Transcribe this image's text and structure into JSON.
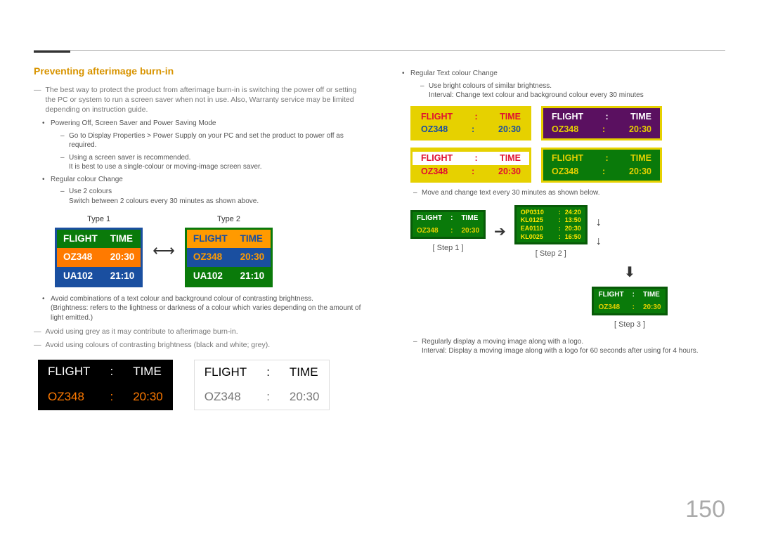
{
  "page_number": "150",
  "section_title": "Preventing afterimage burn-in",
  "intro": "The best way to protect the product from afterimage burn-in is switching the power off or setting the PC or system to run a screen saver when not in use. Also, Warranty service may be limited depending on instruction guide.",
  "b1": "Powering Off, Screen Saver and Power Saving Mode",
  "b1s1": "Go to Display Properties > Power Supply on your PC and set the product to power off as required.",
  "b1s2": "Using a screen saver is recommended.",
  "b1s2b": "It is best to use a single-colour or moving-image screen saver.",
  "b2": "Regular colour Change",
  "b2s1": "Use 2 colours",
  "b2s1b": "Switch between 2 colours every 30 minutes as shown above.",
  "type1_label": "Type 1",
  "type2_label": "Type 2",
  "ft_h1": "FLIGHT",
  "ft_h2": "TIME",
  "ft_r1a": "OZ348",
  "ft_r1b": "20:30",
  "ft_r2a": "UA102",
  "ft_r2b": "21:10",
  "b3": "Avoid combinations of a text colour and background colour of contrasting brightness.",
  "b3b": "(Brightness: refers to the lightness or darkness of a colour which varies depending on the amount of light emitted.)",
  "note1": "Avoid using grey as it may contribute to afterimage burn-in.",
  "note2": "Avoid using colours of contrasting brightness (black and white; grey).",
  "rc_b1": "Regular Text colour Change",
  "rc_b1s1": "Use bright colours of similar brightness.",
  "rc_b1s1b": "Interval: Change text colour and background colour every 30 minutes",
  "rc_sub2": "Move and change text every 30 minutes as shown below.",
  "step1_lbl": "[ Step 1 ]",
  "step2_lbl": "[ Step 2 ]",
  "step3_lbl": "[ Step 3 ]",
  "s2r1a": "OP0310",
  "s2r1b": "24:20",
  "s2r2a": "KL0125",
  "s2r2b": "13:50",
  "s2r3a": "EA0110",
  "s2r3b": "20:30",
  "s2r4a": "KL0025",
  "s2r4b": "16:50",
  "rc_b2s": "Regularly display a moving image along with a logo.",
  "rc_b2sb": "Interval: Display a moving image along with a logo for 60 seconds after using for 4 hours."
}
